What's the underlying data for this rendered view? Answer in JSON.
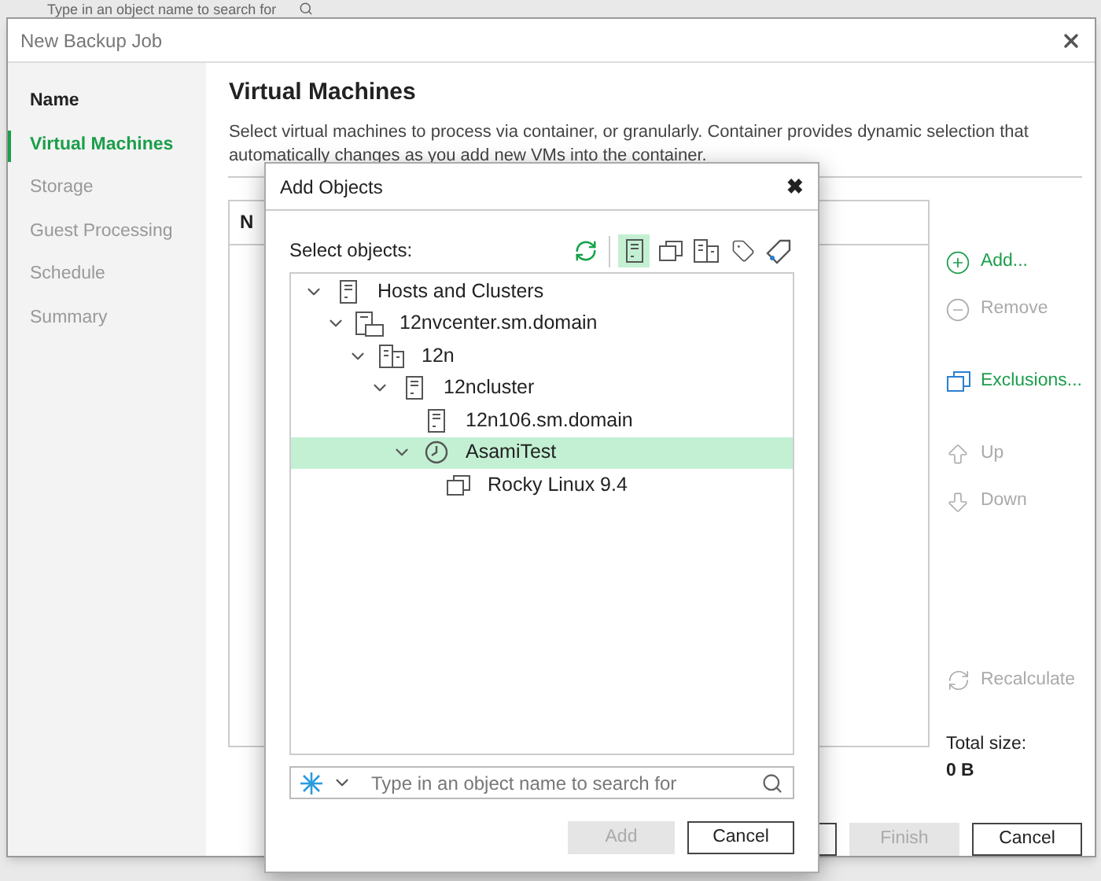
{
  "background_search": {
    "placeholder": "Type in an object name to search for"
  },
  "window": {
    "title": "New Backup Job"
  },
  "sidebar": {
    "items": [
      {
        "label": "Name",
        "selected": false,
        "enabled": true
      },
      {
        "label": "Virtual Machines",
        "selected": true,
        "enabled": true
      },
      {
        "label": "Storage",
        "selected": false,
        "enabled": false
      },
      {
        "label": "Guest Processing",
        "selected": false,
        "enabled": false
      },
      {
        "label": "Schedule",
        "selected": false,
        "enabled": false
      },
      {
        "label": "Summary",
        "selected": false,
        "enabled": false
      }
    ]
  },
  "page": {
    "title": "Virtual Machines",
    "description": "Select virtual machines to process via container, or granularly. Container provides dynamic selection that automatically changes as you add new VMs into the container."
  },
  "table": {
    "columns": [
      "N"
    ]
  },
  "actions": [
    {
      "kind": "add",
      "label": "Add...",
      "disabled": false
    },
    {
      "kind": "remove",
      "label": "Remove",
      "disabled": true
    },
    {
      "kind": "exclusions",
      "label": "Exclusions...",
      "disabled": false
    },
    {
      "kind": "up",
      "label": "Up",
      "disabled": true
    },
    {
      "kind": "down",
      "label": "Down",
      "disabled": true
    },
    {
      "kind": "recalculate",
      "label": "Recalculate",
      "disabled": true
    }
  ],
  "total_size": {
    "label": "Total size:",
    "value": "0 B"
  },
  "footer_buttons": [
    {
      "disabled": false
    },
    {
      "label": "Finish",
      "disabled": true
    },
    {
      "label": "Cancel",
      "disabled": false
    }
  ],
  "dialog": {
    "title": "Add Objects",
    "close": "✖",
    "select_label": "Select objects:",
    "toolbar": [
      {
        "kind": "refresh",
        "selected": false
      },
      {
        "kind": "hosts",
        "selected": true
      },
      {
        "kind": "vms",
        "selected": false
      },
      {
        "kind": "datastores",
        "selected": false
      },
      {
        "kind": "tags",
        "selected": false
      },
      {
        "kind": "user_tags",
        "selected": false
      }
    ],
    "tree": [
      {
        "kind": "hosts_and_clusters",
        "label": "Hosts and Clusters",
        "expanded": true,
        "selected": false,
        "children": [
          {
            "kind": "vcenter",
            "label": "12nvcenter.sm.domain",
            "expanded": true,
            "selected": false,
            "children": [
              {
                "kind": "datacenter",
                "label": "12n",
                "expanded": true,
                "selected": false,
                "children": [
                  {
                    "kind": "cluster",
                    "label": "12ncluster",
                    "expanded": true,
                    "selected": false,
                    "children": [
                      {
                        "kind": "host",
                        "label": "12n106.sm.domain",
                        "selected": false
                      },
                      {
                        "kind": "vapp",
                        "label": "AsamiTest",
                        "expanded": true,
                        "selected": true,
                        "children": [
                          {
                            "kind": "vm",
                            "label": "Rocky Linux 9.4",
                            "selected": false
                          }
                        ]
                      }
                    ]
                  }
                ]
              }
            ]
          }
        ]
      }
    ],
    "search": {
      "placeholder": "Type in an object name to search for"
    },
    "buttons": [
      {
        "label": "Add",
        "disabled": true
      },
      {
        "label": "Cancel",
        "disabled": false
      }
    ]
  }
}
